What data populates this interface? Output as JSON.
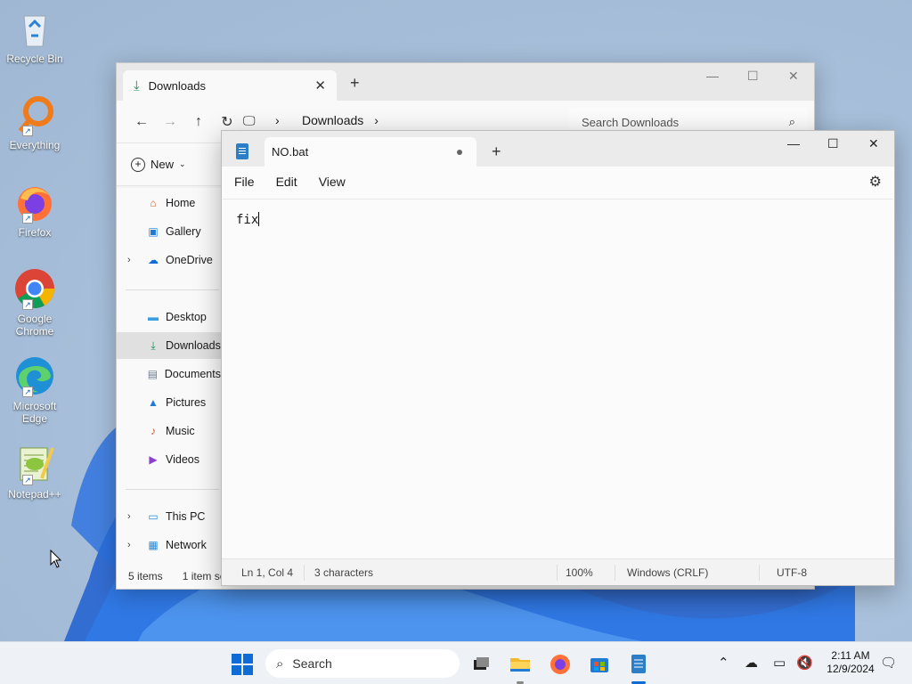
{
  "desktop": {
    "icons": [
      {
        "label": "Recycle Bin"
      },
      {
        "label": "Everything"
      },
      {
        "label": "Firefox"
      },
      {
        "label": "Google Chrome"
      },
      {
        "label": "Microsoft Edge"
      },
      {
        "label": "Notepad++"
      }
    ]
  },
  "explorer": {
    "tab_title": "Downloads",
    "breadcrumb": "Downloads",
    "search_placeholder": "Search Downloads",
    "new_label": "New",
    "sidebar": [
      {
        "label": "Home"
      },
      {
        "label": "Gallery"
      },
      {
        "label": "OneDrive"
      },
      {
        "label": "Desktop"
      },
      {
        "label": "Downloads"
      },
      {
        "label": "Documents"
      },
      {
        "label": "Pictures"
      },
      {
        "label": "Music"
      },
      {
        "label": "Videos"
      },
      {
        "label": "This PC"
      },
      {
        "label": "Network"
      }
    ],
    "status_items": "5 items",
    "status_selected": "1 item se"
  },
  "notepad": {
    "tab_title": "NO.bat",
    "menu": [
      "File",
      "Edit",
      "View"
    ],
    "content": "fix",
    "status": {
      "position": "Ln 1, Col 4",
      "chars": "3 characters",
      "zoom": "100%",
      "line_ending": "Windows (CRLF)",
      "encoding": "UTF-8"
    }
  },
  "taskbar": {
    "search_label": "Search",
    "time": "2:11 AM",
    "date": "12/9/2024"
  },
  "colors": {
    "accent": "#0f6cd6",
    "downloads_green": "#1a8a5c"
  }
}
